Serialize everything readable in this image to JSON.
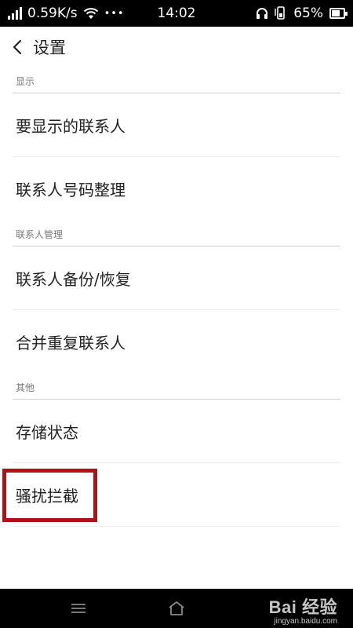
{
  "status_bar": {
    "net_speed": "0.59K/s",
    "dots": "•••",
    "time": "14:02",
    "battery": "65%",
    "icons": [
      "signal-icon",
      "wifi-icon",
      "headset-icon",
      "mobile-signal-icon",
      "battery-icon"
    ]
  },
  "header": {
    "back_icon": "chevron-left-icon",
    "title": "设置"
  },
  "sections": [
    {
      "title": "显示",
      "items": [
        {
          "label": "要显示的联系人"
        },
        {
          "label": "联系人号码整理"
        }
      ]
    },
    {
      "title": "联系人管理",
      "items": [
        {
          "label": "联系人备份/恢复"
        },
        {
          "label": "合并重复联系人"
        }
      ]
    },
    {
      "title": "其他",
      "items": [
        {
          "label": "存储状态"
        },
        {
          "label": "骚扰拦截"
        }
      ]
    }
  ],
  "highlight": {
    "target": "骚扰拦截",
    "color": "#b01116"
  },
  "nav_bar": {
    "icons": [
      "menu-icon",
      "home-icon"
    ]
  },
  "watermark": {
    "top": "Bai 经验",
    "bottom": "jingyan.baidu.com"
  }
}
